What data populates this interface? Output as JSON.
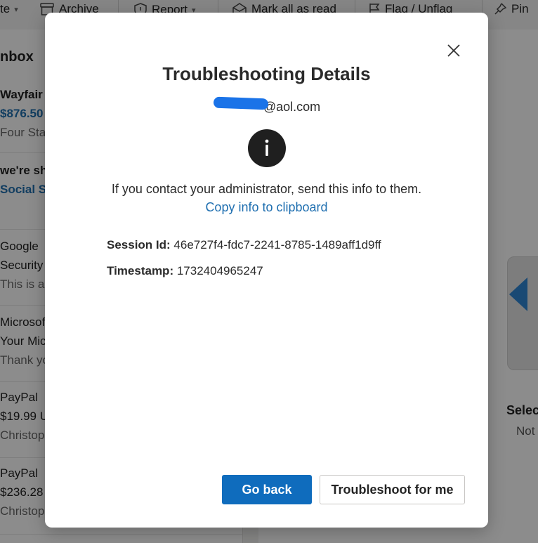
{
  "toolbar": {
    "items": [
      "te",
      "Archive",
      "Report",
      "Mark all as read",
      "Flag / Unflag",
      "Pin"
    ]
  },
  "mail_list": {
    "folder": "nbox",
    "messages": [
      {
        "sender": "Wayfair",
        "subject": "$876.50",
        "preview": "Four Sta"
      },
      {
        "sender": "we're sh",
        "subject": "Social Se",
        "preview": ""
      },
      {
        "sender": "Google",
        "subject": "Security",
        "preview": "This is a"
      },
      {
        "sender": "Microsof",
        "subject": "Your Mic",
        "preview": "Thank yo"
      },
      {
        "sender": "PayPal",
        "subject": "$19.99 U",
        "preview": "Christop"
      },
      {
        "sender": "PayPal",
        "subject": "$236.28",
        "preview": "Christop"
      }
    ]
  },
  "reading_pane": {
    "title": "Selec",
    "subtitle": "Not"
  },
  "dialog": {
    "title": "Troubleshooting Details",
    "email": "@aol.com",
    "message": "If you contact your administrator, send this info to them.",
    "copy_link": "Copy info to clipboard",
    "session_label": "Session Id:",
    "session_value": "46e727f4-fdc7-2241-8785-1489aff1d9ff",
    "timestamp_label": "Timestamp:",
    "timestamp_value": "1732404965247",
    "go_back_label": "Go back",
    "troubleshoot_label": "Troubleshoot for me"
  },
  "colors": {
    "primary": "#0f6cbd",
    "link": "#1f6fb0",
    "redaction": "#1a73e8"
  }
}
